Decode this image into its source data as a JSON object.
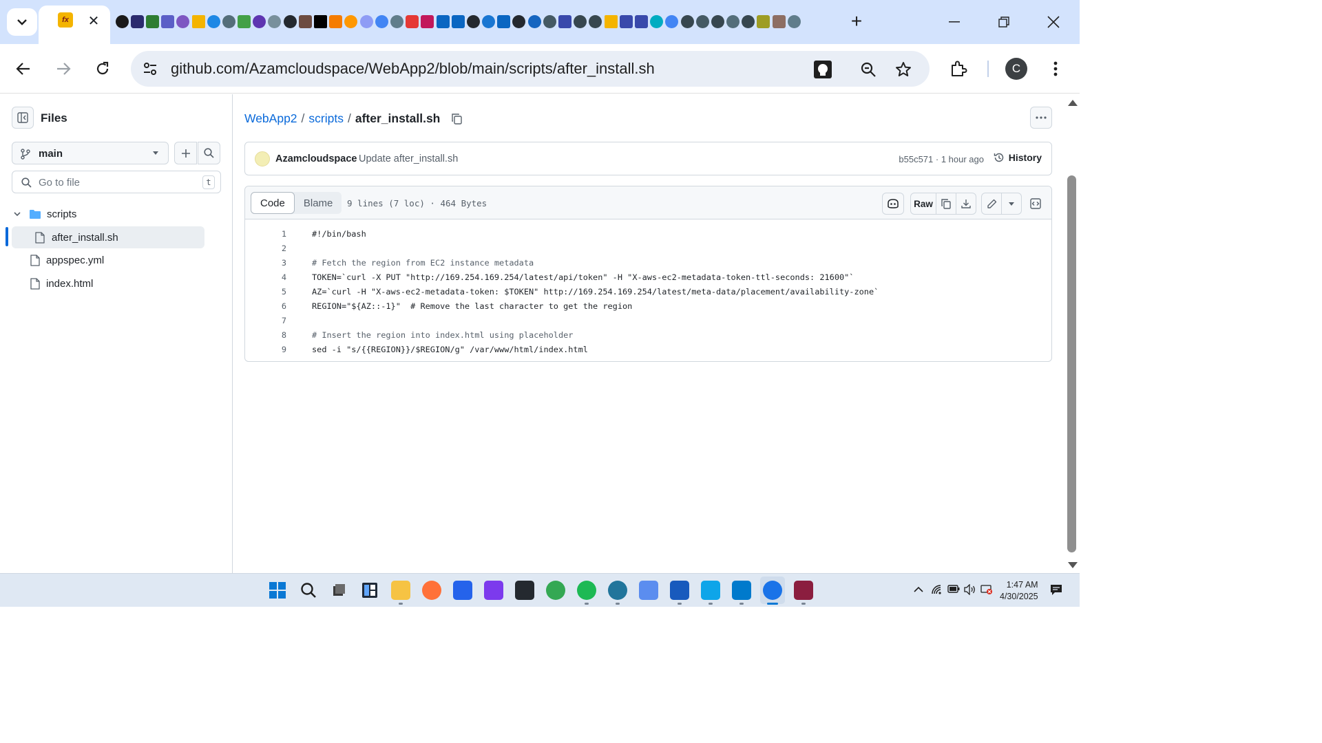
{
  "browser": {
    "address_url": "github.com/Azamcloudspace/WebApp2/blob/main/scripts/after_install.sh",
    "profile_initial": "C",
    "new_tab_label": "+"
  },
  "sidebar": {
    "title": "Files",
    "branch": "main",
    "goto_placeholder": "Go to file",
    "goto_shortcut": "t",
    "tree": [
      {
        "label": "scripts",
        "type": "folder"
      },
      {
        "label": "after_install.sh",
        "type": "file",
        "selected": true
      },
      {
        "label": "appspec.yml",
        "type": "file"
      },
      {
        "label": "index.html",
        "type": "file"
      }
    ]
  },
  "breadcrumb": {
    "repo": "WebApp2",
    "folder": "scripts",
    "file": "after_install.sh",
    "sep": "/"
  },
  "commit": {
    "author": "Azamcloudspace",
    "message": "Update after_install.sh",
    "sha_time": "b55c571 · 1 hour ago",
    "history_label": "History"
  },
  "file_header": {
    "tab_code": "Code",
    "tab_blame": "Blame",
    "info": "9 lines (7 loc) · 464 Bytes",
    "raw_label": "Raw"
  },
  "code_lines": [
    {
      "n": "1",
      "text": "#!/bin/bash"
    },
    {
      "n": "2",
      "text": ""
    },
    {
      "n": "3",
      "text": "# Fetch the region from EC2 instance metadata"
    },
    {
      "n": "4",
      "text": "TOKEN=`curl -X PUT \"http://169.254.169.254/latest/api/token\" -H \"X-aws-ec2-metadata-token-ttl-seconds: 21600\"`"
    },
    {
      "n": "5",
      "text": "AZ=`curl -H \"X-aws-ec2-metadata-token: $TOKEN\" http://169.254.169.254/latest/meta-data/placement/availability-zone`"
    },
    {
      "n": "6",
      "text": "REGION=\"${AZ::-1}\"  # Remove the last character to get the region"
    },
    {
      "n": "7",
      "text": ""
    },
    {
      "n": "8",
      "text": "# Insert the region into index.html using placeholder"
    },
    {
      "n": "9",
      "text": "sed -i \"s/{{REGION}}/$REGION/g\" /var/www/html/index.html"
    }
  ],
  "taskbar": {
    "time": "1:47 AM",
    "date": "4/30/2025"
  },
  "colors": {
    "link": "#0969da",
    "tabstrip": "#d3e3fd",
    "taskbar": "#dfe8f3"
  }
}
